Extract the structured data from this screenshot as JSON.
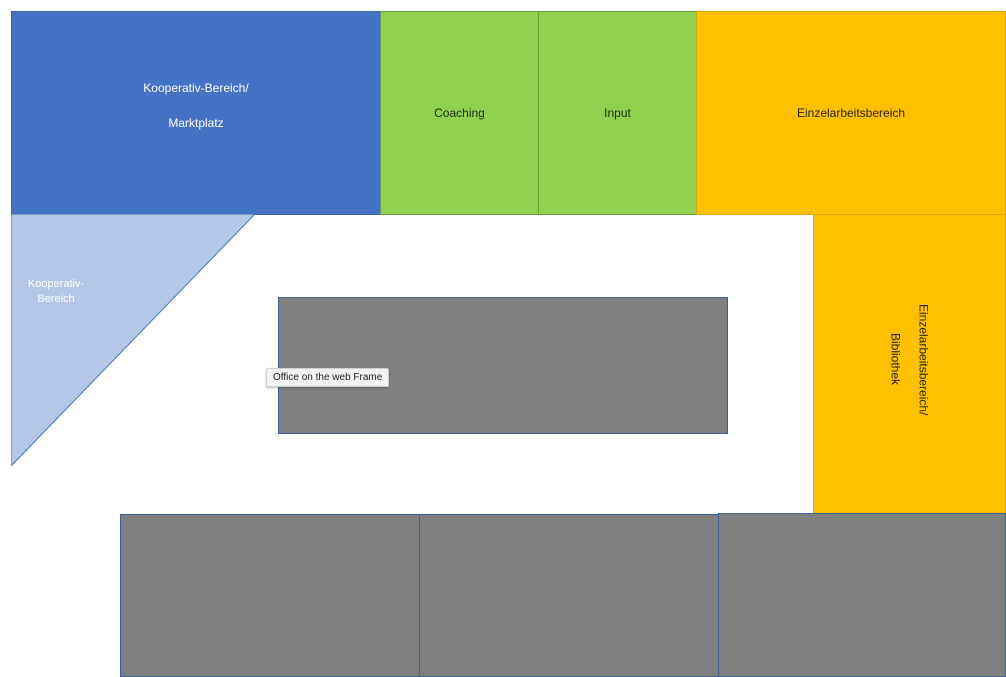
{
  "areas": {
    "kooperativ_marktplatz": {
      "line1": "Kooperativ-Bereich/",
      "line2": "Marktplatz"
    },
    "coaching": {
      "label": "Coaching"
    },
    "input": {
      "label": "Input"
    },
    "einzelarbeit_top": {
      "label": "Einzelarbeitsbereich"
    },
    "einzelarbeit_bibliothek": {
      "line1": "Einzelarbeitsbereich/",
      "line2": "Bibliothek"
    },
    "kooperativ_small": {
      "line1": "Kooperativ-",
      "line2": "Bereich"
    }
  },
  "tooltip": {
    "text": "Office on the web Frame"
  },
  "colors": {
    "blue": "#4472c4",
    "light_blue": "#b4c7e7",
    "green": "#92d050",
    "orange": "#ffc000",
    "gray": "#808080"
  }
}
